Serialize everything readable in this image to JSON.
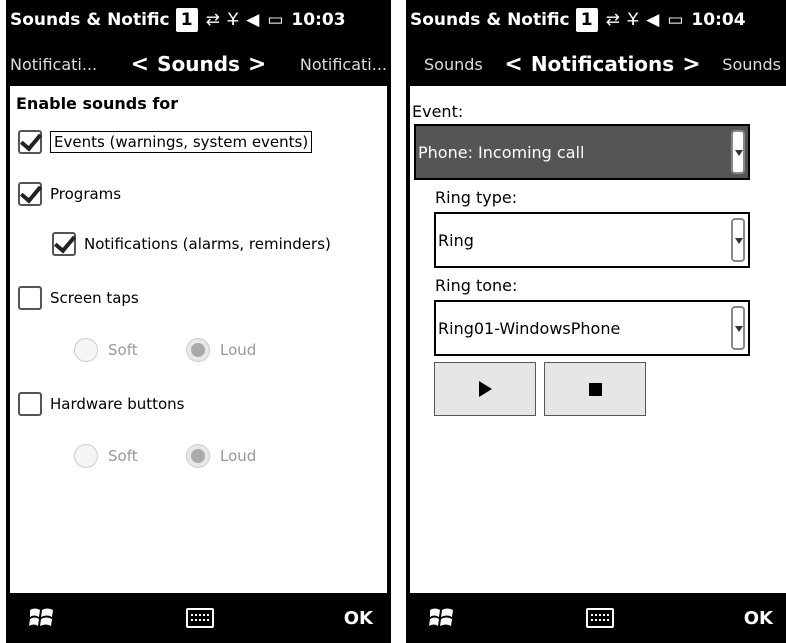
{
  "left": {
    "status": {
      "title": "Sounds & Notific",
      "badge": "1",
      "time": "10:03"
    },
    "nav": {
      "prev": "Notificati...",
      "current": "Sounds",
      "next": "Notificati..."
    },
    "heading": "Enable sounds for",
    "options": {
      "events": {
        "label": "Events (warnings, system events)",
        "checked": true
      },
      "programs": {
        "label": "Programs",
        "checked": true
      },
      "notifications": {
        "label": "Notifications (alarms, reminders)",
        "checked": true
      },
      "screen_taps": {
        "label": "Screen taps",
        "checked": false,
        "soft": "Soft",
        "loud": "Loud",
        "selected": "Loud"
      },
      "hardware_buttons": {
        "label": "Hardware buttons",
        "checked": false,
        "soft": "Soft",
        "loud": "Loud",
        "selected": "Loud"
      }
    },
    "bottom": {
      "ok": "OK"
    }
  },
  "right": {
    "status": {
      "title": "Sounds & Notific",
      "badge": "1",
      "time": "10:04"
    },
    "nav": {
      "prev": "Sounds",
      "current": "Notifications",
      "next": "Sounds"
    },
    "event_label": "Event:",
    "event_value": "Phone: Incoming call",
    "ring_type_label": "Ring type:",
    "ring_type_value": "Ring",
    "ring_tone_label": "Ring tone:",
    "ring_tone_value": "Ring01-WindowsPhone",
    "bottom": {
      "ok": "OK"
    }
  },
  "icons": {
    "status": [
      "app-switch-icon",
      "data-arrows-icon",
      "no-signal-icon",
      "volume-icon",
      "battery-icon"
    ],
    "bottom": [
      "windows-start-icon",
      "keyboard-icon"
    ],
    "player": [
      "play-icon",
      "stop-icon"
    ]
  },
  "colors": {
    "bar": "#000000",
    "selected_field": "#555555",
    "content": "#ffffff"
  }
}
